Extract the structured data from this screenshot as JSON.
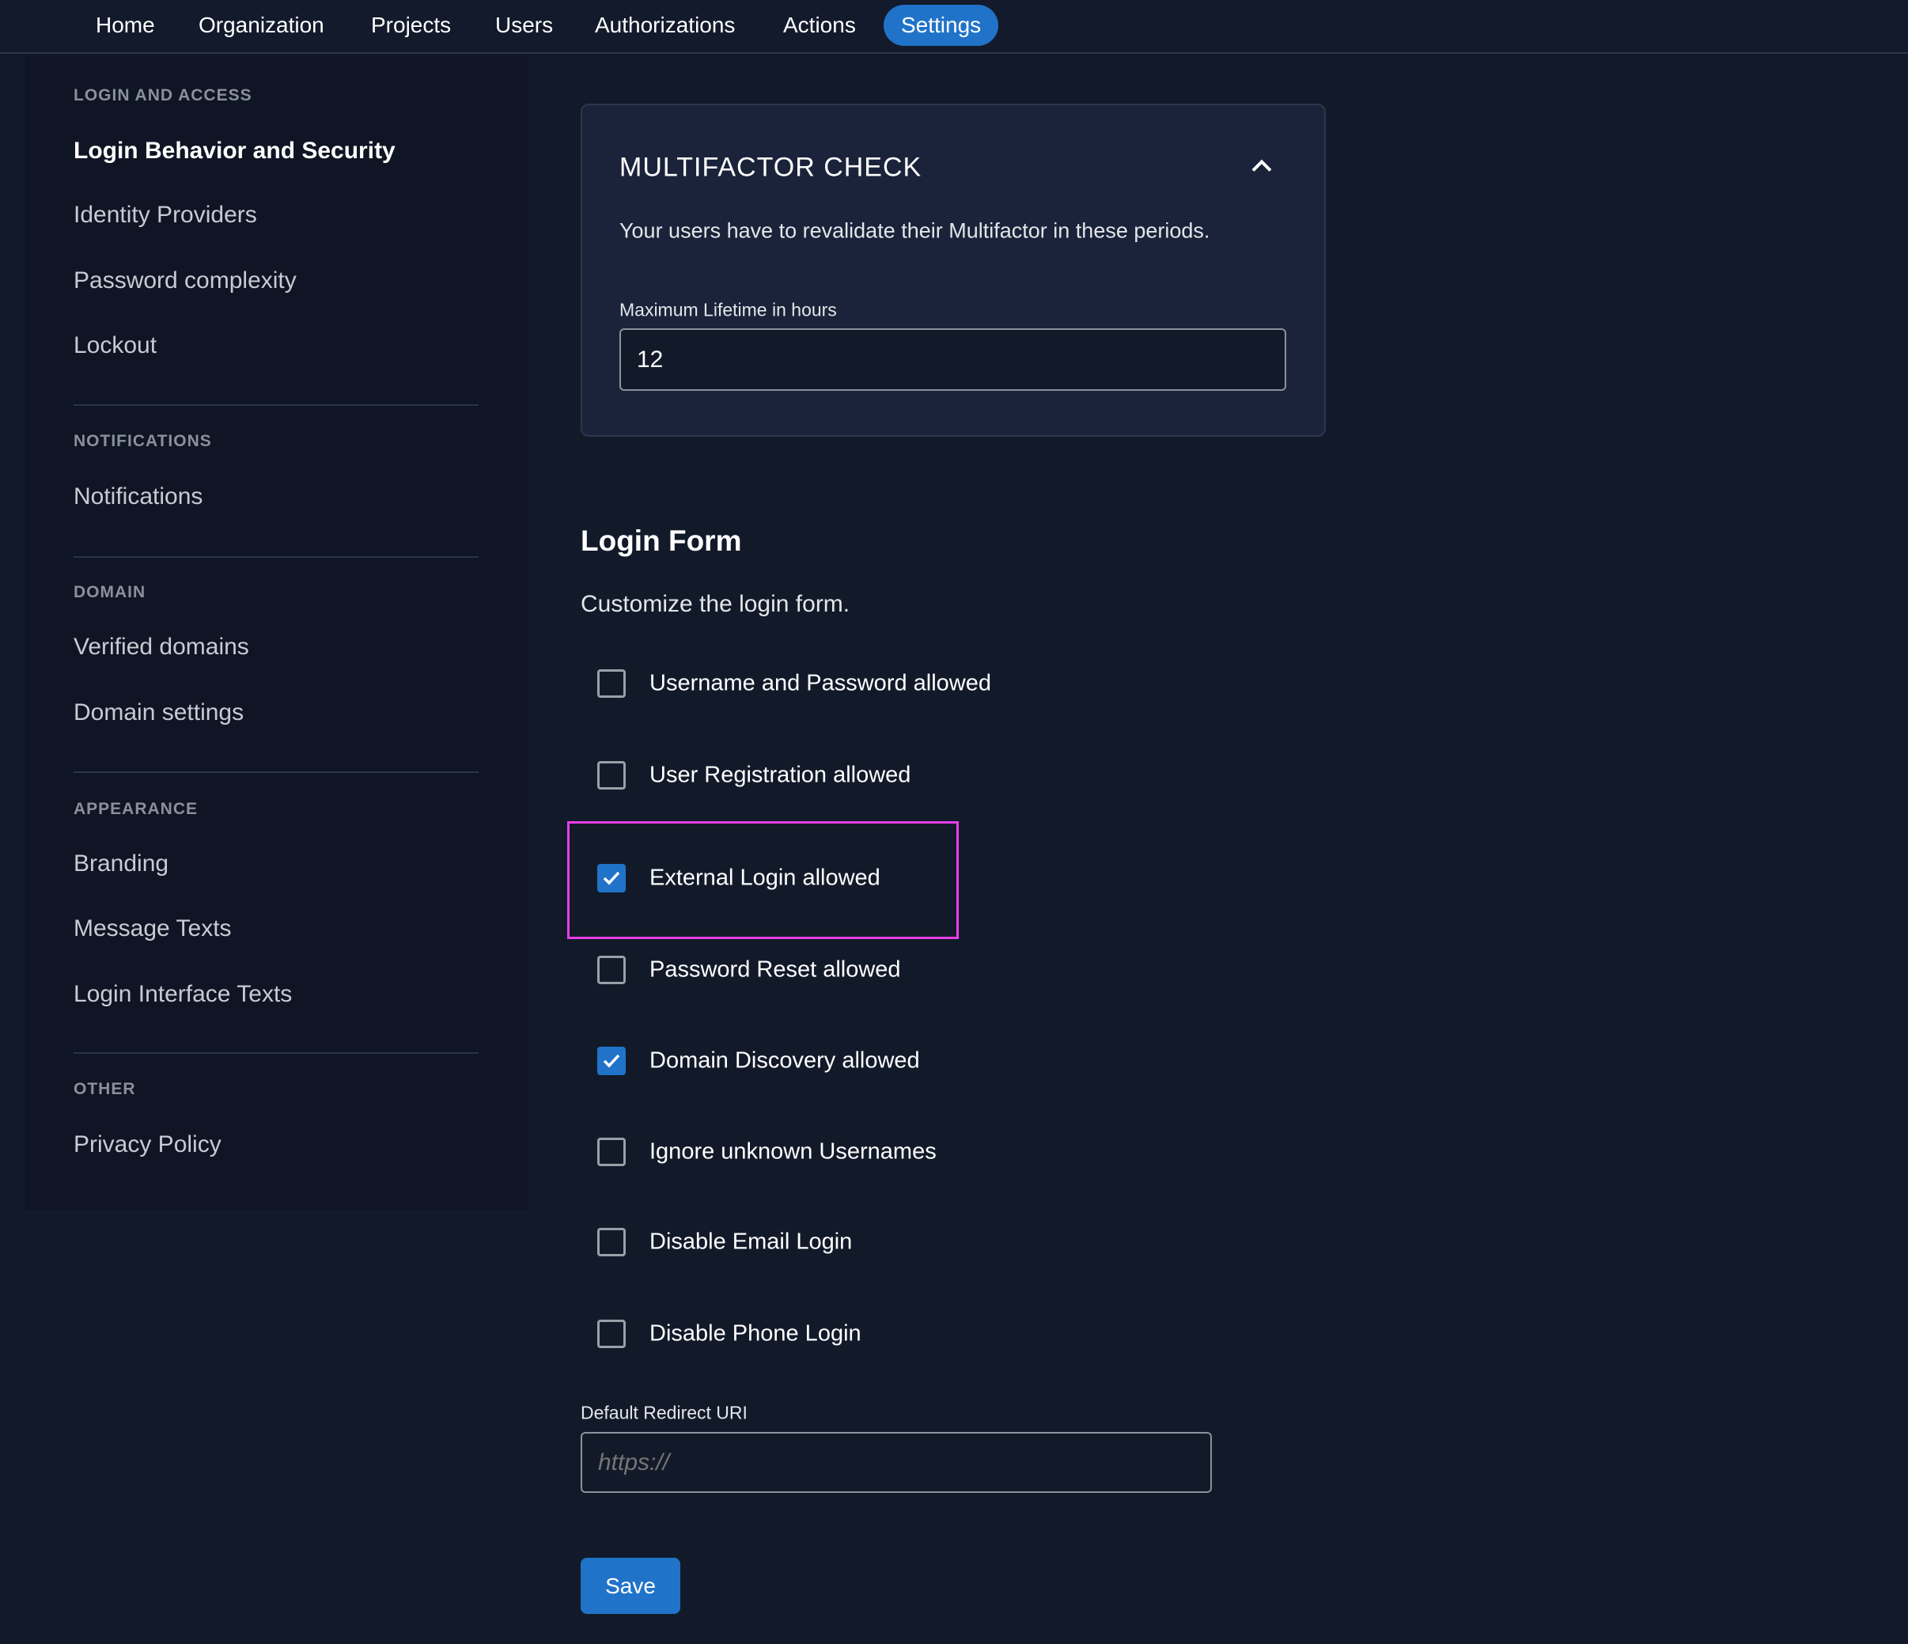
{
  "nav": {
    "items": [
      "Home",
      "Organization",
      "Projects",
      "Users",
      "Authorizations",
      "Actions",
      "Settings"
    ],
    "active": "Settings"
  },
  "sidebar": {
    "sections": [
      {
        "header": "LOGIN AND ACCESS",
        "items": [
          "Login Behavior and Security",
          "Identity Providers",
          "Password complexity",
          "Lockout"
        ]
      },
      {
        "header": "NOTIFICATIONS",
        "items": [
          "Notifications"
        ]
      },
      {
        "header": "DOMAIN",
        "items": [
          "Verified domains",
          "Domain settings"
        ]
      },
      {
        "header": "APPEARANCE",
        "items": [
          "Branding",
          "Message Texts",
          "Login Interface Texts"
        ]
      },
      {
        "header": "OTHER",
        "items": [
          "Privacy Policy"
        ]
      }
    ],
    "active": "Login Behavior and Security"
  },
  "mfa": {
    "title": "MULTIFACTOR CHECK",
    "description": "Your users have to revalidate their Multifactor in these periods.",
    "field_label": "Maximum Lifetime in hours",
    "field_value": "12"
  },
  "login_form": {
    "title": "Login Form",
    "description": "Customize the login form.",
    "options": [
      {
        "label": "Username and Password allowed",
        "checked": false
      },
      {
        "label": "User Registration allowed",
        "checked": false
      },
      {
        "label": "External Login allowed",
        "checked": true
      },
      {
        "label": "Password Reset allowed",
        "checked": false
      },
      {
        "label": "Domain Discovery allowed",
        "checked": true
      },
      {
        "label": "Ignore unknown Usernames",
        "checked": false
      },
      {
        "label": "Disable Email Login",
        "checked": false
      },
      {
        "label": "Disable Phone Login",
        "checked": false
      }
    ],
    "redirect_label": "Default Redirect URI",
    "redirect_placeholder": "https://",
    "redirect_value": "",
    "save_label": "Save"
  },
  "colors": {
    "accent": "#2073c8",
    "highlight": "#e83ee8",
    "background": "#121a2a"
  }
}
